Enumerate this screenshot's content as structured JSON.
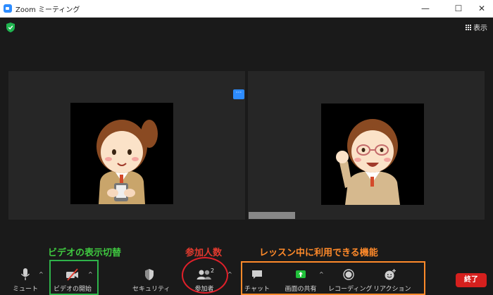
{
  "window": {
    "title": "Zoom ミーティング",
    "minimize": "—",
    "maximize": "☐",
    "close": "✕"
  },
  "view_button": {
    "label": "表示",
    "icon": "grid-icon"
  },
  "more_button": {
    "label": "···"
  },
  "colors": {
    "accent": "#2d8cff",
    "end": "#d5201e",
    "share_green": "#20c03a",
    "annotation_green": "#3fc940",
    "annotation_red": "#e23a2e",
    "annotation_orange": "#ff8a2a"
  },
  "toolbar": {
    "mute": "ミュート",
    "video": "ビデオの開始",
    "security": "セキュリティ",
    "participants": "参加者",
    "participants_count": "2",
    "chat": "チャット",
    "share": "画面の共有",
    "record": "レコーディング",
    "reaction": "リアクション",
    "end": "終了"
  },
  "annotations": {
    "video_toggle": "ビデオの表示切替",
    "participant_count": "参加人数",
    "lesson_features": "レッスン中に利用できる機能"
  }
}
